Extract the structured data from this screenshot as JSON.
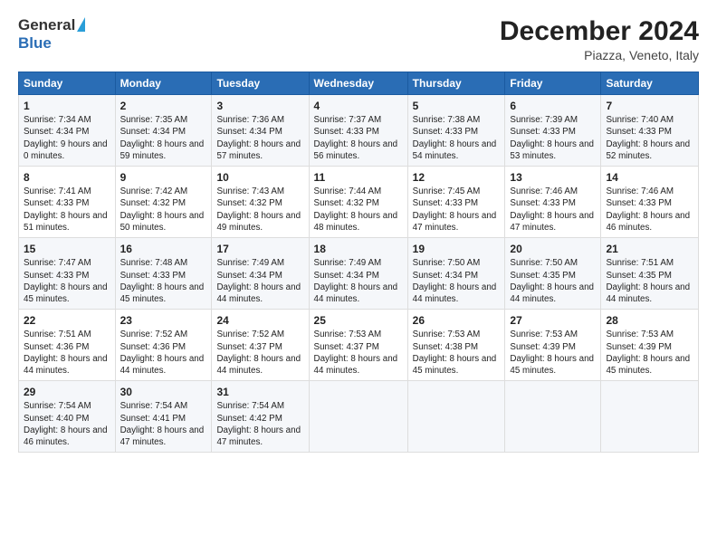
{
  "logo": {
    "general": "General",
    "blue": "Blue"
  },
  "title": "December 2024",
  "subtitle": "Piazza, Veneto, Italy",
  "days_header": [
    "Sunday",
    "Monday",
    "Tuesday",
    "Wednesday",
    "Thursday",
    "Friday",
    "Saturday"
  ],
  "weeks": [
    [
      {
        "day": "1",
        "sunrise": "7:34 AM",
        "sunset": "4:34 PM",
        "daylight": "9 hours and 0 minutes."
      },
      {
        "day": "2",
        "sunrise": "7:35 AM",
        "sunset": "4:34 PM",
        "daylight": "8 hours and 59 minutes."
      },
      {
        "day": "3",
        "sunrise": "7:36 AM",
        "sunset": "4:34 PM",
        "daylight": "8 hours and 57 minutes."
      },
      {
        "day": "4",
        "sunrise": "7:37 AM",
        "sunset": "4:33 PM",
        "daylight": "8 hours and 56 minutes."
      },
      {
        "day": "5",
        "sunrise": "7:38 AM",
        "sunset": "4:33 PM",
        "daylight": "8 hours and 54 minutes."
      },
      {
        "day": "6",
        "sunrise": "7:39 AM",
        "sunset": "4:33 PM",
        "daylight": "8 hours and 53 minutes."
      },
      {
        "day": "7",
        "sunrise": "7:40 AM",
        "sunset": "4:33 PM",
        "daylight": "8 hours and 52 minutes."
      }
    ],
    [
      {
        "day": "8",
        "sunrise": "7:41 AM",
        "sunset": "4:33 PM",
        "daylight": "8 hours and 51 minutes."
      },
      {
        "day": "9",
        "sunrise": "7:42 AM",
        "sunset": "4:32 PM",
        "daylight": "8 hours and 50 minutes."
      },
      {
        "day": "10",
        "sunrise": "7:43 AM",
        "sunset": "4:32 PM",
        "daylight": "8 hours and 49 minutes."
      },
      {
        "day": "11",
        "sunrise": "7:44 AM",
        "sunset": "4:32 PM",
        "daylight": "8 hours and 48 minutes."
      },
      {
        "day": "12",
        "sunrise": "7:45 AM",
        "sunset": "4:33 PM",
        "daylight": "8 hours and 47 minutes."
      },
      {
        "day": "13",
        "sunrise": "7:46 AM",
        "sunset": "4:33 PM",
        "daylight": "8 hours and 47 minutes."
      },
      {
        "day": "14",
        "sunrise": "7:46 AM",
        "sunset": "4:33 PM",
        "daylight": "8 hours and 46 minutes."
      }
    ],
    [
      {
        "day": "15",
        "sunrise": "7:47 AM",
        "sunset": "4:33 PM",
        "daylight": "8 hours and 45 minutes."
      },
      {
        "day": "16",
        "sunrise": "7:48 AM",
        "sunset": "4:33 PM",
        "daylight": "8 hours and 45 minutes."
      },
      {
        "day": "17",
        "sunrise": "7:49 AM",
        "sunset": "4:34 PM",
        "daylight": "8 hours and 44 minutes."
      },
      {
        "day": "18",
        "sunrise": "7:49 AM",
        "sunset": "4:34 PM",
        "daylight": "8 hours and 44 minutes."
      },
      {
        "day": "19",
        "sunrise": "7:50 AM",
        "sunset": "4:34 PM",
        "daylight": "8 hours and 44 minutes."
      },
      {
        "day": "20",
        "sunrise": "7:50 AM",
        "sunset": "4:35 PM",
        "daylight": "8 hours and 44 minutes."
      },
      {
        "day": "21",
        "sunrise": "7:51 AM",
        "sunset": "4:35 PM",
        "daylight": "8 hours and 44 minutes."
      }
    ],
    [
      {
        "day": "22",
        "sunrise": "7:51 AM",
        "sunset": "4:36 PM",
        "daylight": "8 hours and 44 minutes."
      },
      {
        "day": "23",
        "sunrise": "7:52 AM",
        "sunset": "4:36 PM",
        "daylight": "8 hours and 44 minutes."
      },
      {
        "day": "24",
        "sunrise": "7:52 AM",
        "sunset": "4:37 PM",
        "daylight": "8 hours and 44 minutes."
      },
      {
        "day": "25",
        "sunrise": "7:53 AM",
        "sunset": "4:37 PM",
        "daylight": "8 hours and 44 minutes."
      },
      {
        "day": "26",
        "sunrise": "7:53 AM",
        "sunset": "4:38 PM",
        "daylight": "8 hours and 45 minutes."
      },
      {
        "day": "27",
        "sunrise": "7:53 AM",
        "sunset": "4:39 PM",
        "daylight": "8 hours and 45 minutes."
      },
      {
        "day": "28",
        "sunrise": "7:53 AM",
        "sunset": "4:39 PM",
        "daylight": "8 hours and 45 minutes."
      }
    ],
    [
      {
        "day": "29",
        "sunrise": "7:54 AM",
        "sunset": "4:40 PM",
        "daylight": "8 hours and 46 minutes."
      },
      {
        "day": "30",
        "sunrise": "7:54 AM",
        "sunset": "4:41 PM",
        "daylight": "8 hours and 47 minutes."
      },
      {
        "day": "31",
        "sunrise": "7:54 AM",
        "sunset": "4:42 PM",
        "daylight": "8 hours and 47 minutes."
      },
      null,
      null,
      null,
      null
    ]
  ],
  "labels": {
    "sunrise": "Sunrise:",
    "sunset": "Sunset:",
    "daylight": "Daylight:"
  }
}
